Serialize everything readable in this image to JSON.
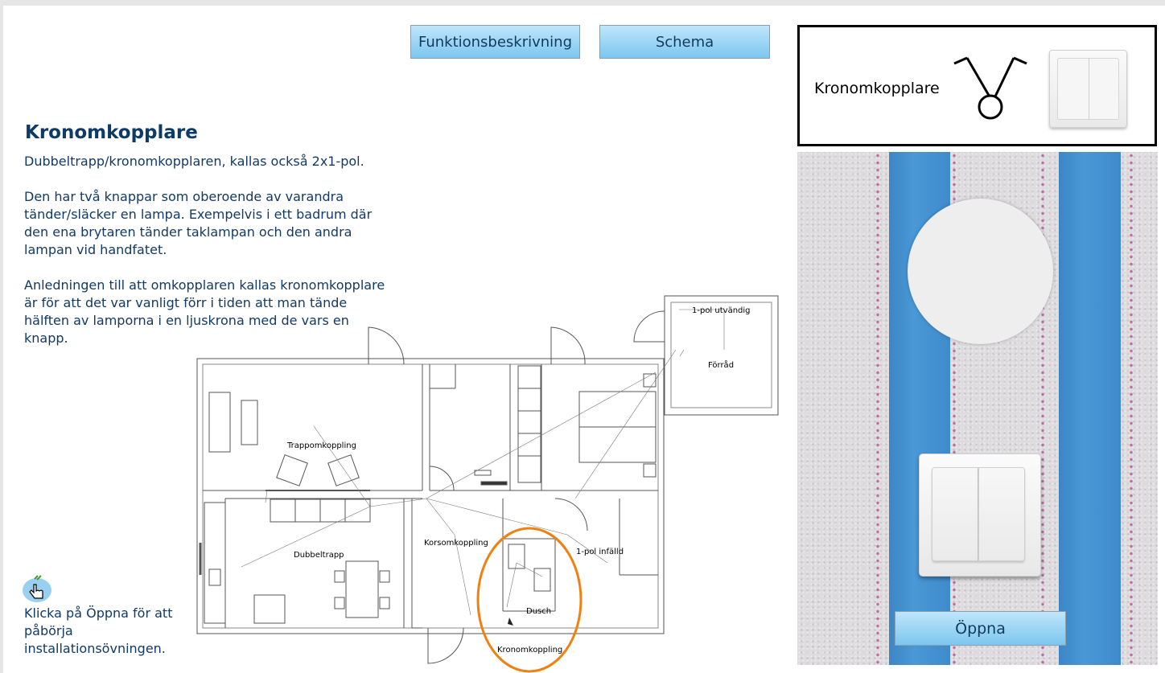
{
  "toolbar": {
    "function_label": "Funktionsbeskrivning",
    "schema_label": "Schema"
  },
  "content": {
    "title": "Kronomkopplare",
    "paragraph1": "Dubbeltrapp/kronomkopplaren, kallas också 2x1-pol.",
    "paragraph2": "Den har två knappar som oberoende av varandra tänder/släcker en lampa. Exempelvis i ett badrum där den ena brytaren tänder taklampan och den andra lampan vid handfatet.",
    "paragraph3": "Anledningen till att omkopplaren kallas kronomkopplare är för att det var vanligt förr i tiden att man tände hälften av lamporna i en ljuskrona med de vars en knapp."
  },
  "floorplan": {
    "labels": {
      "outdoor": "1-pol utvändig",
      "storage": "Förråd",
      "stair": "Trappomkoppling",
      "double_stair": "Dubbeltrapp",
      "cross": "Korsomkoppling",
      "recessed": "1-pol infälld",
      "shower": "Dusch",
      "crown": "Kronomkoppling"
    },
    "highlight_color": "#f08010"
  },
  "hint": {
    "text": "Klicka på Öppna för att påbörja installationsövningen.",
    "icon": "hand-pointer-icon"
  },
  "legend": {
    "label": "Kronomkopplare"
  },
  "simulation": {
    "open_label": "Öppna",
    "stripe_color": "#3f8acb"
  }
}
